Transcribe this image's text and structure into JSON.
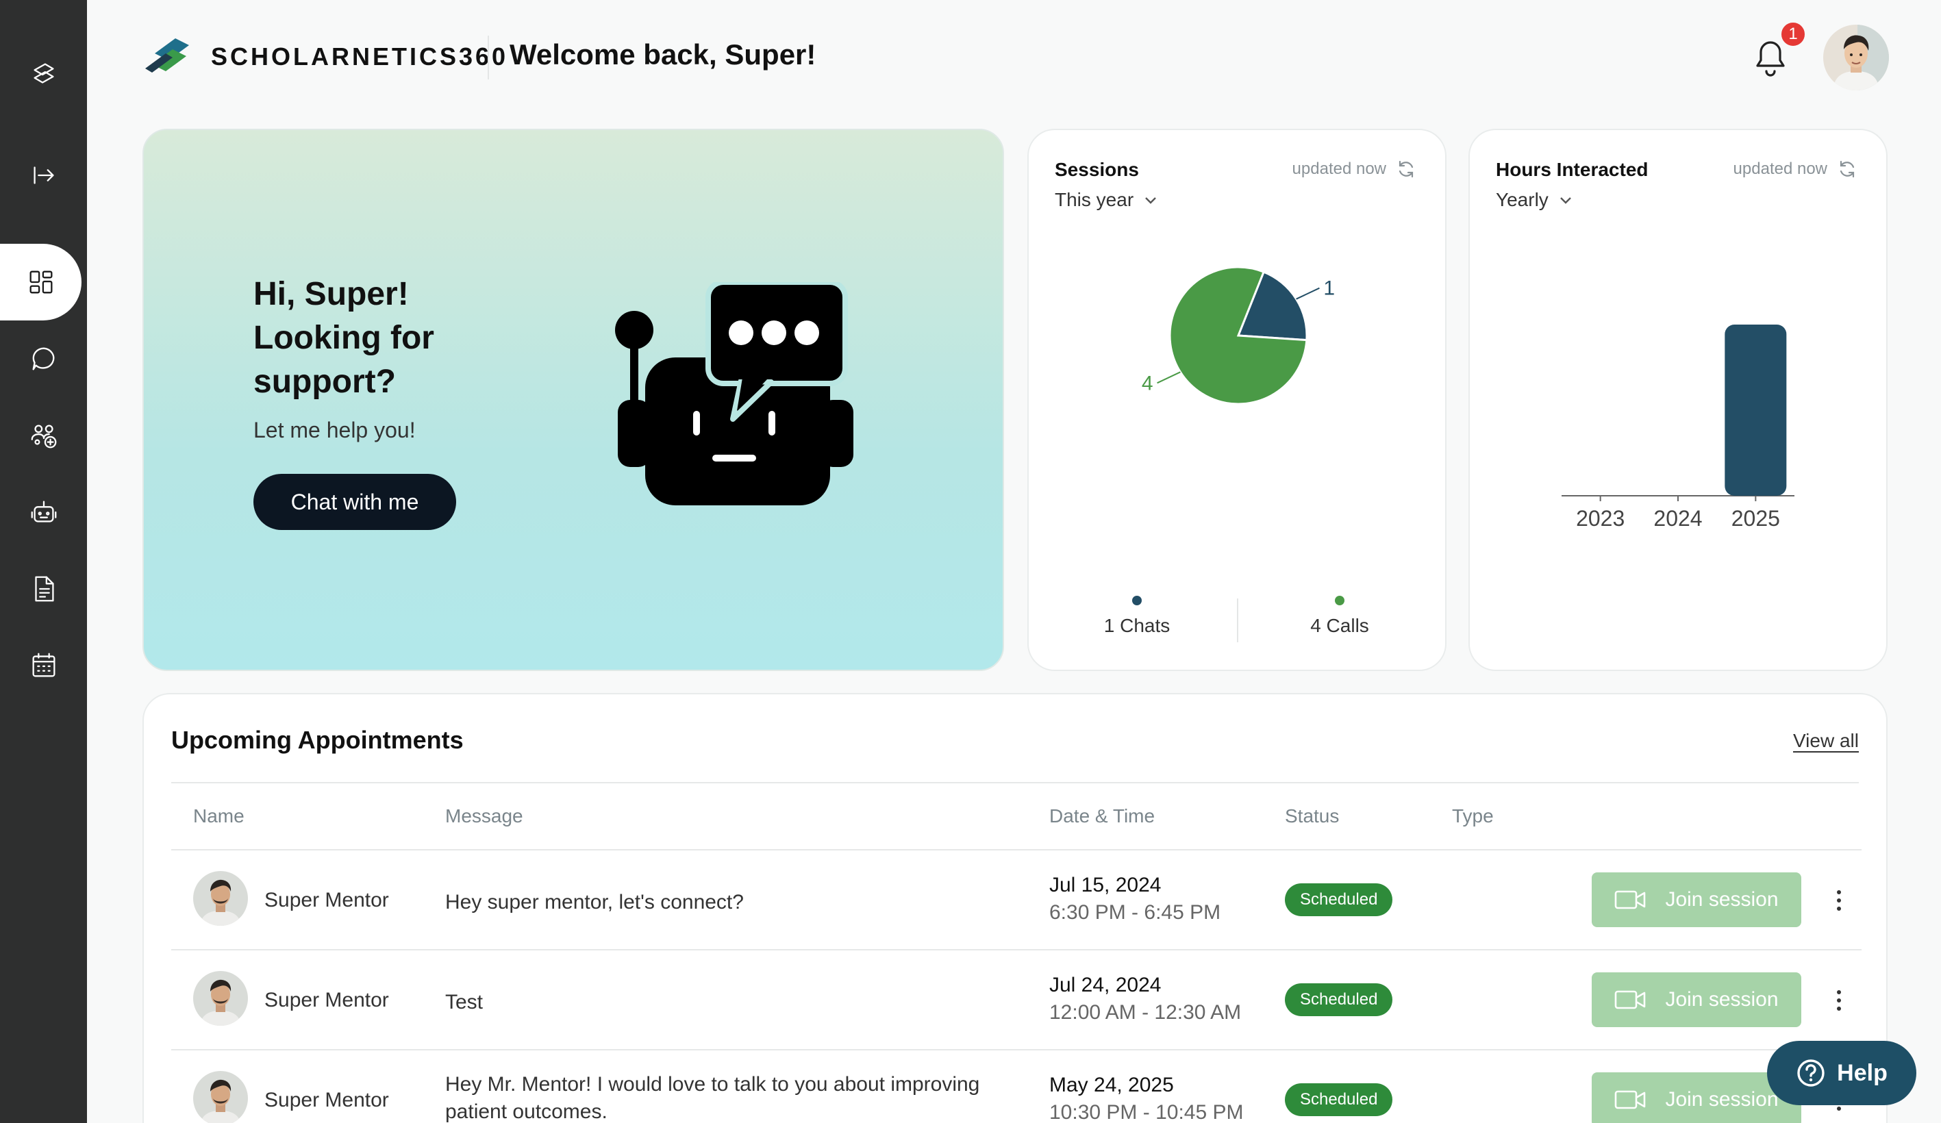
{
  "brand": {
    "name": "SCHOLARNETICS360",
    "accent_green": "#3a9a4a",
    "accent_blue": "#1f6f8b"
  },
  "header": {
    "welcome": "Welcome back, Super!",
    "notification_count": "1"
  },
  "sidebar": {
    "items": [
      {
        "name": "logo-icon"
      },
      {
        "name": "expand-sidebar-icon"
      },
      {
        "name": "dashboard-icon",
        "active": true
      },
      {
        "name": "chat-icon"
      },
      {
        "name": "mentors-icon"
      },
      {
        "name": "bot-icon"
      },
      {
        "name": "document-icon"
      },
      {
        "name": "calendar-icon"
      }
    ]
  },
  "hero": {
    "title": "Hi, Super! Looking for support?",
    "subtitle": "Let me help you!",
    "button": "Chat with me"
  },
  "sessions": {
    "title": "Sessions",
    "updated": "updated now",
    "filter": "This year",
    "chats_legend": "1 Chats",
    "calls_legend": "4 Calls"
  },
  "hours": {
    "title": "Hours Interacted",
    "updated": "updated now",
    "filter": "Yearly"
  },
  "chart_data": [
    {
      "type": "pie",
      "labels": [
        "Chats",
        "Calls"
      ],
      "values": [
        1,
        4
      ],
      "slice_labels": [
        "1",
        "4"
      ],
      "colors": [
        "#234e66",
        "#4a9a46"
      ]
    },
    {
      "type": "bar",
      "categories": [
        "2023",
        "2024",
        "2025"
      ],
      "values": [
        0,
        0,
        1
      ],
      "ylim": [
        0,
        1.2
      ],
      "colors": [
        "#234e66"
      ]
    }
  ],
  "appointments": {
    "title": "Upcoming Appointments",
    "view_all": "View all",
    "columns": [
      "Name",
      "Message",
      "Date & Time",
      "Status",
      "Type"
    ],
    "join_label": "Join session",
    "rows": [
      {
        "name": "Super Mentor",
        "message": "Hey super mentor, let's connect?",
        "date": "Jul 15, 2024",
        "time": "6:30 PM - 6:45 PM",
        "status": "Scheduled"
      },
      {
        "name": "Super Mentor",
        "message": "Test",
        "date": "Jul 24, 2024",
        "time": "12:00 AM - 12:30 AM",
        "status": "Scheduled"
      },
      {
        "name": "Super Mentor",
        "message": "Hey Mr. Mentor! I would love to talk to you about improving patient outcomes.",
        "date": "May 24, 2025",
        "time": "10:30 PM - 10:45 PM",
        "status": "Scheduled"
      }
    ]
  },
  "help": {
    "label": "Help"
  }
}
